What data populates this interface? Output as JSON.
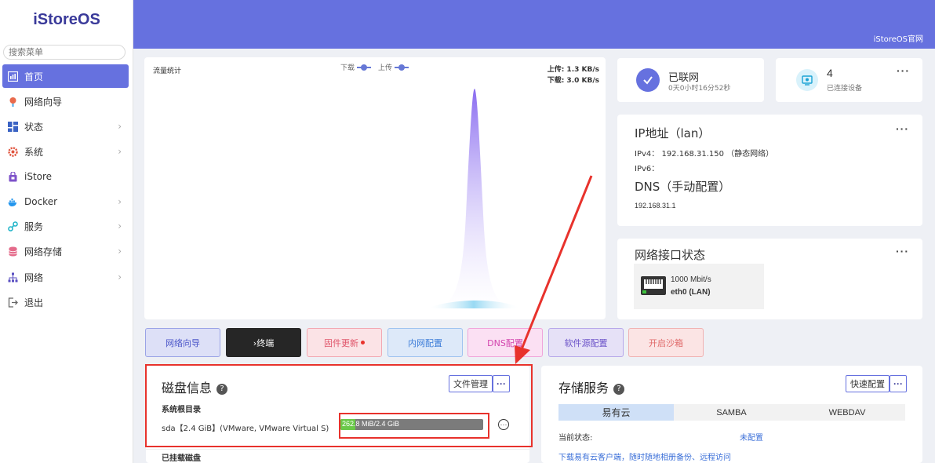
{
  "sidebar": {
    "logo": "iStoreOS",
    "search_placeholder": "搜索菜单",
    "items": [
      {
        "label": "首页"
      },
      {
        "label": "网络向导"
      },
      {
        "label": "状态"
      },
      {
        "label": "系统"
      },
      {
        "label": "iStore"
      },
      {
        "label": "Docker"
      },
      {
        "label": "服务"
      },
      {
        "label": "网络存储"
      },
      {
        "label": "网络"
      },
      {
        "label": "退出"
      }
    ]
  },
  "header": {
    "site_link": "iStoreOS官网"
  },
  "traffic": {
    "title": "流量统计",
    "legend_download": "下载",
    "legend_upload": "上传",
    "upload_rate": "上传: 1.3 KB/s",
    "download_rate": "下载: 3.0 KB/s"
  },
  "quick_buttons": [
    {
      "label": "网络向导"
    },
    {
      "label": "›终端"
    },
    {
      "label": "固件更新"
    },
    {
      "label": "内网配置"
    },
    {
      "label": "DNS配置"
    },
    {
      "label": "软件源配置"
    },
    {
      "label": "开启沙箱"
    }
  ],
  "status": {
    "connected_title": "已联网",
    "uptime": "0天0小时16分52秒",
    "device_count": "4",
    "device_label": "已连接设备"
  },
  "ip": {
    "title": "IP地址（lan）",
    "ipv4_label": "IPv4：",
    "ipv4_value": "192.168.31.150 （静态网络）",
    "ipv6_label": "IPv6：",
    "dns_title": "DNS（手动配置）",
    "dns_value": "192.168.31.1"
  },
  "iface": {
    "title": "网络接口状态",
    "speed": "1000 Mbit/s",
    "name": "eth0 (LAN)"
  },
  "disk": {
    "title": "磁盘信息",
    "file_manager": "文件管理",
    "root_section": "系统根目录",
    "disk_name": "sda【2.4 GiB】(VMware, VMware Virtual S)",
    "usage_text": "262.8 MiB/2.4 GiB",
    "usage_fraction": 0.107,
    "mounted_section": "已挂载磁盘"
  },
  "storage": {
    "title": "存储服务",
    "quick_config": "快速配置",
    "tabs": [
      {
        "label": "易有云"
      },
      {
        "label": "SAMBA"
      },
      {
        "label": "WEBDAV"
      }
    ],
    "state_label": "当前状态:",
    "state_value": "未配置",
    "download_hint": "下载易有云客户端，随时随地相册备份、远程访问"
  }
}
